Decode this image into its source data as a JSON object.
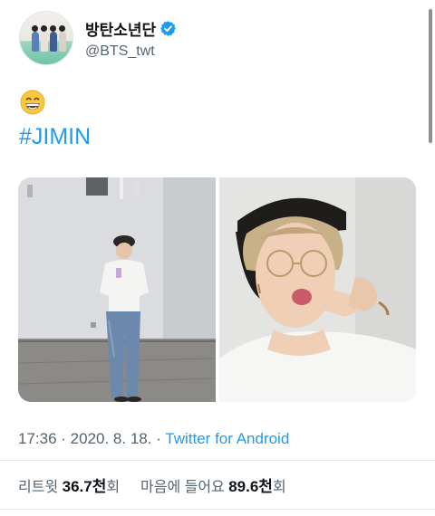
{
  "tweet": {
    "author": {
      "display_name": "방탄소년단",
      "handle": "@BTS_twt",
      "verified": true,
      "verified_color": "#1d9bf0"
    },
    "emoji": "grinning-face-with-smiling-eyes",
    "hashtag": "#JIMIN",
    "media": [
      {
        "name": "mirror-selfie-photo"
      },
      {
        "name": "close-up-selfie-photo"
      }
    ],
    "time": "17:36",
    "separator": " · ",
    "date": "2020. 8. 18.",
    "separator2": " · ",
    "source": "Twitter for Android",
    "stats": {
      "retweets_label": "리트윗",
      "retweets_value": "36.7천",
      "retweets_unit": "회",
      "likes_label": "마음에 들어요",
      "likes_value": "89.6천",
      "likes_unit": "회"
    }
  },
  "colors": {
    "link": "#1d9bf0",
    "secondary_text": "#536471",
    "primary_text": "#0f1419"
  }
}
